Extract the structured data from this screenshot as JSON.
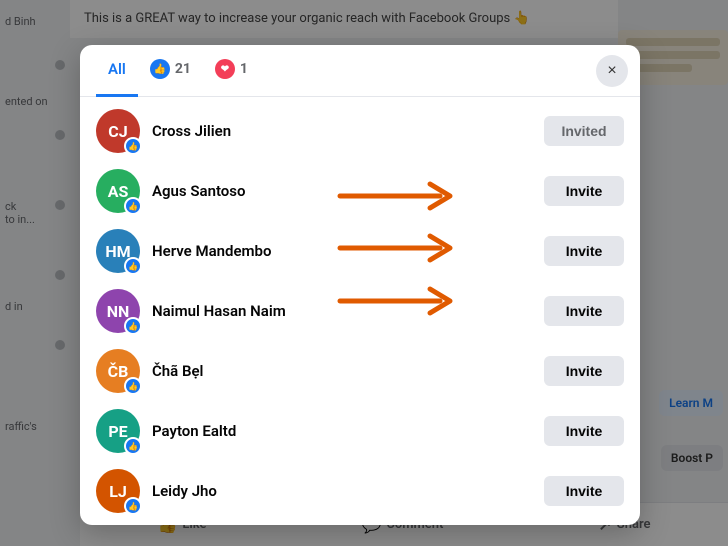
{
  "background": {
    "post_text": "This is a GREAT way to increase your organic reach with Facebook Groups 👆",
    "left_labels": [
      "d Binh",
      "ented on",
      "ck\nto in...",
      "d in",
      "raffic's"
    ],
    "action_bar": {
      "like": "Like",
      "comment": "Comment",
      "share": "Share"
    },
    "right_panel": {
      "learn_label": "Learn M",
      "boost_label": "Boost P"
    }
  },
  "modal": {
    "tabs": [
      {
        "id": "all",
        "label": "All",
        "active": true
      },
      {
        "id": "likes",
        "count": "21",
        "type": "like"
      },
      {
        "id": "loves",
        "count": "1",
        "type": "love"
      }
    ],
    "close_label": "×",
    "users": [
      {
        "name": "Cross Jilien",
        "button": "Invited",
        "invited": true,
        "color": "#c0392b",
        "initials": "CJ"
      },
      {
        "name": "Agus Santoso",
        "button": "Invite",
        "invited": false,
        "color": "#27ae60",
        "initials": "AS",
        "arrow": true
      },
      {
        "name": "Herve Mandembo",
        "button": "Invite",
        "invited": false,
        "color": "#2980b9",
        "initials": "HM",
        "arrow": true
      },
      {
        "name": "Naimul Hasan Naim",
        "button": "Invite",
        "invited": false,
        "color": "#8e44ad",
        "initials": "NN",
        "arrow": true
      },
      {
        "name": "Čhã Bẹl",
        "button": "Invite",
        "invited": false,
        "color": "#e67e22",
        "initials": "ČB"
      },
      {
        "name": "Payton Ealtd",
        "button": "Invite",
        "invited": false,
        "color": "#16a085",
        "initials": "PE"
      },
      {
        "name": "Leidy Jho",
        "button": "Invite",
        "invited": false,
        "color": "#d35400",
        "initials": "LJ"
      }
    ]
  }
}
